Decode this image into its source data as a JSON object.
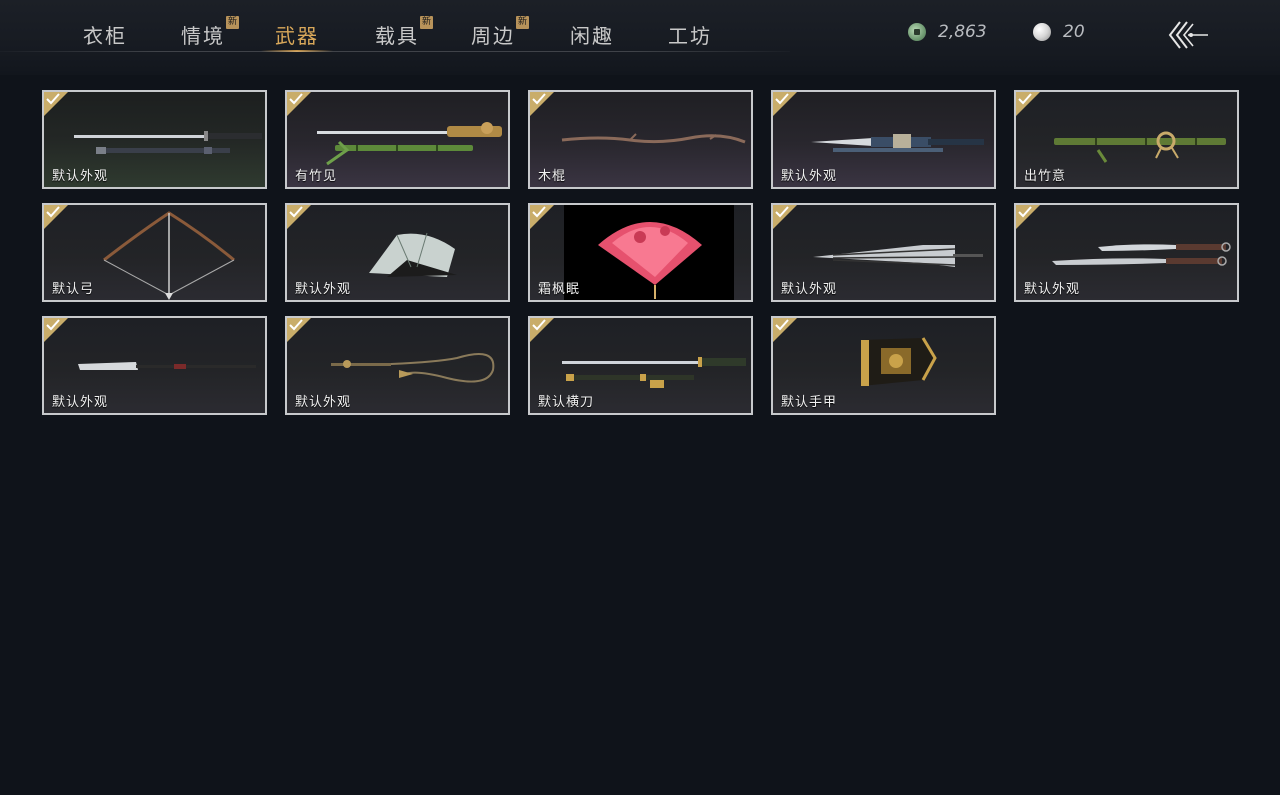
{
  "tabs": [
    {
      "label": "衣柜",
      "new": false,
      "active": false,
      "new_badge": ""
    },
    {
      "label": "情境",
      "new": true,
      "active": false,
      "new_badge": "新"
    },
    {
      "label": "武器",
      "new": false,
      "active": true,
      "new_badge": ""
    },
    {
      "label": "载具",
      "new": true,
      "active": false,
      "new_badge": "新"
    },
    {
      "label": "周边",
      "new": true,
      "active": false,
      "new_badge": "新"
    },
    {
      "label": "闲趣",
      "new": false,
      "active": false,
      "new_badge": ""
    },
    {
      "label": "工坊",
      "new": false,
      "active": false,
      "new_badge": ""
    }
  ],
  "currency": {
    "coins": {
      "icon": "jade-coin-icon",
      "value": "2,863"
    },
    "pearls": {
      "icon": "pearl-icon",
      "value": "20"
    }
  },
  "back_icon": "back-arrow-icon",
  "colors": {
    "accent": "#d9a85a",
    "check": "#c9ad6a",
    "background": "#0f131a",
    "card_border": "#c7c9cc"
  },
  "weapons": [
    {
      "label": "默认外观",
      "icon": "sword-with-scabbard-icon",
      "owned": true
    },
    {
      "label": "有竹见",
      "icon": "bamboo-sword-icon",
      "owned": true
    },
    {
      "label": "木棍",
      "icon": "wooden-stick-icon",
      "owned": true
    },
    {
      "label": "默认外观",
      "icon": "ornate-blade-icon",
      "owned": true
    },
    {
      "label": "出竹意",
      "icon": "bamboo-staff-icon",
      "owned": true
    },
    {
      "label": "默认弓",
      "icon": "bow-icon",
      "owned": true
    },
    {
      "label": "默认外观",
      "icon": "folding-fan-icon",
      "owned": true
    },
    {
      "label": "霜枫眠",
      "icon": "red-maple-fan-icon",
      "owned": true
    },
    {
      "label": "默认外观",
      "icon": "umbrella-icon",
      "owned": true
    },
    {
      "label": "默认外观",
      "icon": "dual-sabres-icon",
      "owned": true
    },
    {
      "label": "默认外观",
      "icon": "glaive-icon",
      "owned": true
    },
    {
      "label": "默认外观",
      "icon": "rope-dart-icon",
      "owned": true
    },
    {
      "label": "默认横刀",
      "icon": "hengdao-sabre-icon",
      "owned": true
    },
    {
      "label": "默认手甲",
      "icon": "gauntlet-icon",
      "owned": true
    }
  ]
}
